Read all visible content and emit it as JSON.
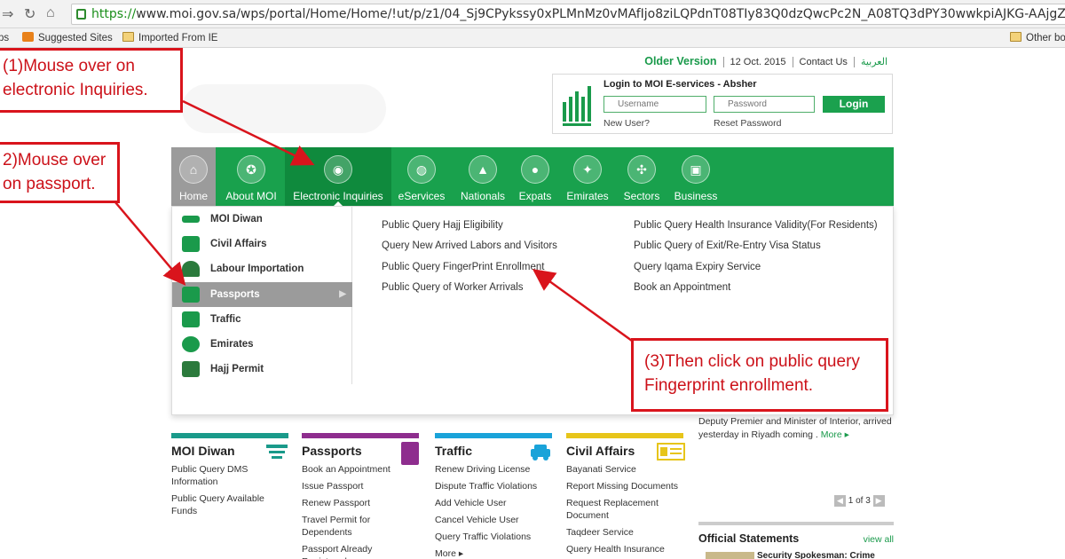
{
  "browser": {
    "url_scheme": "https://",
    "url_rest": "www.moi.gov.sa/wps/portal/Home/Home/!ut/p/z1/04_Sj9CPykssy0xPLMnMz0vMAfIjo8ziLQPdnT08TIy83Q0dzQwcPc2N_A08TQ3dPY30wwkpiAJKG-AAjgZA",
    "bookmarks": [
      "ps",
      "Suggested Sites",
      "Imported From IE",
      "Other bo"
    ]
  },
  "header": {
    "older_version": "Older Version",
    "date": "12 Oct. 2015",
    "contact": "Contact Us",
    "arabic": "العربية"
  },
  "login": {
    "title": "Login to MOI E-services - Absher",
    "username_placeholder": "Username",
    "password_placeholder": "Password",
    "button": "Login",
    "new_user": "New User?",
    "reset": "Reset Password"
  },
  "nav": {
    "items": [
      {
        "label": "Home",
        "icon": "home-icon"
      },
      {
        "label": "About MOI",
        "icon": "emblem-icon"
      },
      {
        "label": "Electronic Inquiries",
        "icon": "fingerprint-icon"
      },
      {
        "label": "eServices",
        "icon": "globe-icon"
      },
      {
        "label": "Nationals",
        "icon": "person-icon"
      },
      {
        "label": "Expats",
        "icon": "group-icon"
      },
      {
        "label": "Emirates",
        "icon": "map-icon"
      },
      {
        "label": "Sectors",
        "icon": "network-icon"
      },
      {
        "label": "Business",
        "icon": "briefcase-icon"
      }
    ]
  },
  "submenu": {
    "items": [
      "MOI Diwan",
      "Civil Affairs",
      "Labour Importation",
      "Passports",
      "Traffic",
      "Emirates",
      "Hajj Permit"
    ]
  },
  "queries": {
    "col1": [
      "Public Query Hajj Eligibility",
      "Query New Arrived Labors and Visitors",
      "Public Query FingerPrint Enrollment",
      "Public Query of Worker Arrivals"
    ],
    "col2": [
      "Public Query Health Insurance Validity(For Residents)",
      "Public Query of Exit/Re-Entry Visa Status",
      "Query Iqama Expiry Service",
      "Book an Appointment"
    ]
  },
  "annotations": {
    "a1_line1": "(1)Mouse over on",
    "a1_line2": "electronic Inquiries.",
    "a2_line1": "2)Mouse over",
    "a2_line2": "on passport.",
    "a3_line1": "(3)Then click on public query",
    "a3_line2": "Fingerprint enrollment."
  },
  "news": {
    "text": "Deputy Premier and Minister of Interior, arrived yesterday in Riyadh coming .",
    "more": "More ▸"
  },
  "sections": [
    {
      "title": "MOI Diwan",
      "color": "#1a9a8a",
      "items": [
        "Public Query DMS Information",
        "Public Query Available Funds"
      ]
    },
    {
      "title": "Passports",
      "color": "#8e2d8e",
      "items": [
        "Book an Appointment",
        "Issue Passport",
        "Renew Passport",
        "Travel Permit for Dependents",
        "Passport Already Registered"
      ]
    },
    {
      "title": "Traffic",
      "color": "#1aa3d9",
      "items": [
        "Renew Driving License",
        "Dispute Traffic Violations",
        "Add Vehicle User",
        "Cancel Vehicle User",
        "Query Traffic Violations",
        "More ▸"
      ]
    },
    {
      "title": "Civil Affairs",
      "color": "#e7c51a",
      "items": [
        "Bayanati Service",
        "Report Missing Documents",
        "Request Replacement Document",
        "Taqdeer Service",
        "Query Health Insurance"
      ]
    }
  ],
  "pager": {
    "text": "1 of 3"
  },
  "official": {
    "title": "Official Statements",
    "view_all": "view all",
    "snippet": "Security Spokesman: Crime"
  },
  "colors": {
    "green": "#19a14d",
    "red": "#d9141c",
    "grey": "#9b9b9b"
  }
}
